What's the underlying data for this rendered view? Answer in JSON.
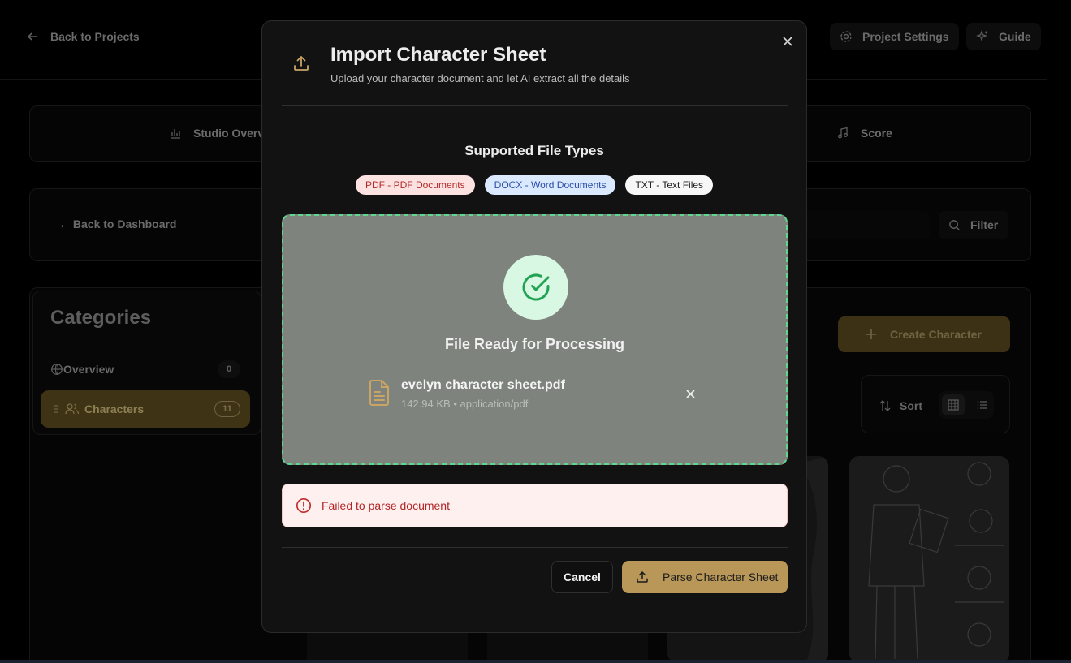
{
  "background": {
    "back_to_projects": "Back to Projects",
    "project_settings": "Project Settings",
    "guide": "Guide",
    "tabs": {
      "studio_overview": "Studio Overv",
      "score": "Score"
    },
    "back_to_dashboard": "← Back to Dashboard",
    "filter": "Filter",
    "categories": {
      "title": "Categories",
      "items": [
        {
          "label": "Overview",
          "count": "0"
        },
        {
          "label": "Characters",
          "count": "11"
        }
      ]
    },
    "create_character": "Create Character",
    "sort": "Sort"
  },
  "modal": {
    "title": "Import Character Sheet",
    "subtitle": "Upload your character document and let AI extract all the details",
    "supported_title": "Supported File Types",
    "file_types": [
      {
        "label": "PDF - PDF Documents",
        "color": "#fde2e2"
      },
      {
        "label": "DOCX - Word Documents",
        "color": "#dbe9fe"
      },
      {
        "label": "TXT - Text Files",
        "color": "#f7f7f7"
      }
    ],
    "dropzone": {
      "status": "File Ready for Processing",
      "file_name": "evelyn character sheet.pdf",
      "file_meta": "142.94 KB • application/pdf"
    },
    "error": "Failed to parse document",
    "cancel": "Cancel",
    "parse": "Parse Character Sheet"
  },
  "colors": {
    "accent": "#b89758",
    "success": "#22a253",
    "error": "#b12525"
  }
}
